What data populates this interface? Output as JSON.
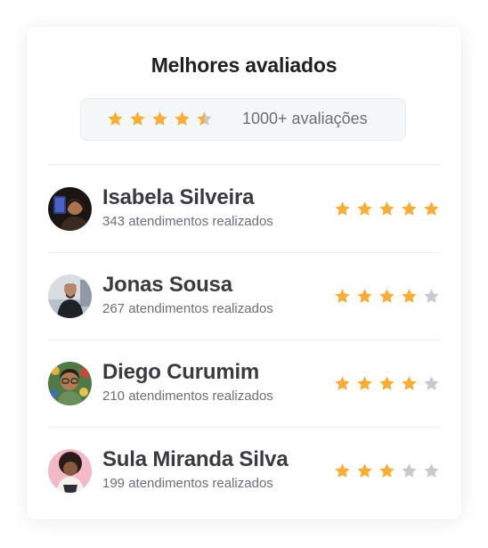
{
  "card": {
    "title": "Melhores avaliados",
    "summary": {
      "rating": 4.5,
      "max_rating": 5,
      "count_label": "1000+ avaliações"
    }
  },
  "colors": {
    "star_filled": "#f7ad36",
    "star_empty": "#c8c9cc",
    "title": "#1f1f24",
    "name": "#3a3b40",
    "muted": "#6b6f76"
  },
  "people": [
    {
      "name": "Isabela Silveira",
      "subtitle": "343 atendimentos realizados",
      "rating": 5,
      "avatar": "avatar-photo"
    },
    {
      "name": "Jonas Sousa",
      "subtitle": "267 atendimentos realizados",
      "rating": 4,
      "avatar": "avatar-photo"
    },
    {
      "name": "Diego Curumim",
      "subtitle": "210 atendimentos realizados",
      "rating": 4,
      "avatar": "avatar-photo"
    },
    {
      "name": "Sula Miranda Silva",
      "subtitle": "199 atendimentos realizados",
      "rating": 3,
      "avatar": "avatar-photo"
    }
  ]
}
